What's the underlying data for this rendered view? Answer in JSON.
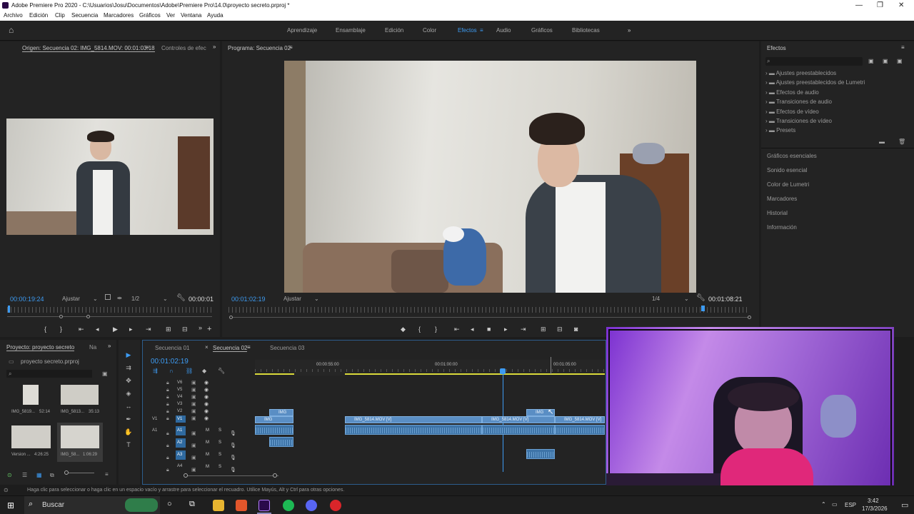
{
  "window": {
    "title": "Adobe Premiere Pro 2020 - C:\\Usuarios\\Josu\\Documentos\\Adobe\\Premiere Pro\\14.0\\proyecto secreto.prproj *"
  },
  "menu": [
    "Archivo",
    "Edición",
    "Clip",
    "Secuencia",
    "Marcadores",
    "Gráficos",
    "Ver",
    "Ventana",
    "Ayuda"
  ],
  "workspaces": {
    "items": [
      "Aprendizaje",
      "Ensamblaje",
      "Edición",
      "Color",
      "Efectos",
      "Audio",
      "Gráficos",
      "Bibliotecas"
    ],
    "active": "Efectos",
    "more": "»"
  },
  "source": {
    "tab": "Origen: Secuencia 02: IMG_5814.MOV: 00:01:03:18",
    "tab2": "Controles de efec",
    "timecode": "00:00:19:24",
    "fit": "Ajustar",
    "quality": "1/2",
    "duration": "00:00:01"
  },
  "program": {
    "tab": "Programa: Secuencia 02",
    "timecode": "00:01:02:19",
    "fit": "Ajustar",
    "quality": "1/4",
    "duration": "00:01:08:21"
  },
  "effects": {
    "title": "Efectos",
    "tree": [
      "Ajustes preestablecidos",
      "Ajustes preestablecidos de Lumetri",
      "Efectos de audio",
      "Transiciones de audio",
      "Efectos de vídeo",
      "Transiciones de vídeo",
      "Presets"
    ],
    "sections": [
      "Gráficos esenciales",
      "Sonido esencial",
      "Color de Lumetri",
      "Marcadores",
      "Historial",
      "Información"
    ]
  },
  "project": {
    "tab": "Proyecto: proyecto secreto",
    "tab2": "Na",
    "file": "proyecto secreto.prproj",
    "items": [
      {
        "name": "IMG_5819...",
        "dur": "52:14"
      },
      {
        "name": "IMG_5813...",
        "dur": "35:13"
      },
      {
        "name": "Version ...",
        "dur": "4:26:25"
      },
      {
        "name": "IMG_58...",
        "dur": "1:06:29"
      }
    ]
  },
  "timeline": {
    "tabs": [
      "Secuencia 01",
      "Secuencia 02",
      "Secuencia 03"
    ],
    "active": "Secuencia 02",
    "timecode": "00:01:02:19",
    "ruler": [
      "00:00:55:00",
      "00:01:00:00",
      "00:01:05:00"
    ],
    "video_tracks": [
      "V6",
      "V5",
      "V4",
      "V3",
      "V2",
      "V1"
    ],
    "audio_tracks": [
      "A1",
      "A2",
      "A3",
      "A4"
    ],
    "src_v": "V1",
    "src_a": "A1",
    "clips": {
      "v2a": "IMG",
      "v1a": "IMG",
      "v1b": "IMG_5814.MOV [V]",
      "v1c": "IMG_5814.MOV [V]",
      "v1d": "IMG_5814.MOV [V]",
      "v2b": "IMG"
    },
    "m": "M",
    "s": "S"
  },
  "status": "Haga clic para seleccionar o haga clic en un espacio vacío y arrastre para seleccionar el recuadro. Utilice Mayús, Alt y Ctrl para otras opciones.",
  "taskbar": {
    "search": "Buscar",
    "lang": "ESP",
    "time": "3:42",
    "date": "17/3/2026"
  }
}
